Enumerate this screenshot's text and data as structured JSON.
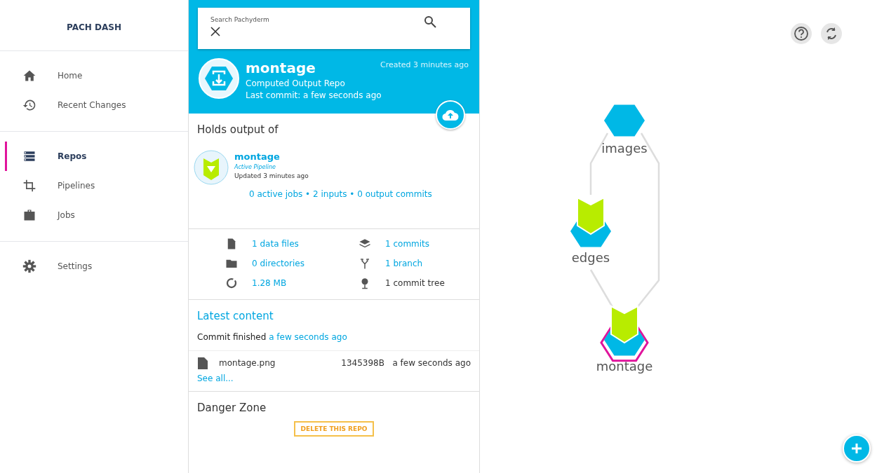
{
  "sidebar": {
    "title": "PACH DASH",
    "groups": [
      {
        "items": [
          {
            "label": "Home",
            "selected": false
          },
          {
            "label": "Recent Changes",
            "selected": false
          }
        ]
      },
      {
        "items": [
          {
            "label": "Repos",
            "selected": true
          },
          {
            "label": "Pipelines",
            "selected": false
          },
          {
            "label": "Jobs",
            "selected": false
          }
        ]
      },
      {
        "items": [
          {
            "label": "Settings",
            "selected": false
          }
        ]
      }
    ]
  },
  "search": {
    "placeholder": "Search Pachyderm"
  },
  "repo": {
    "name": "montage",
    "type": "Computed Output Repo",
    "last_commit": "Last commit: a few seconds ago",
    "created": "Created 3 minutes ago"
  },
  "holds_output": {
    "title": "Holds output of",
    "pipeline": {
      "name": "montage",
      "status": "Active Pipeline",
      "updated": "Updated 3 minutes ago",
      "summary": "0 active jobs • 2 inputs • 0 output commits"
    }
  },
  "stats": [
    {
      "text": "1 data files",
      "link": true
    },
    {
      "text": "1 commits",
      "link": true
    },
    {
      "text": "0 directories",
      "link": true
    },
    {
      "text": "1 branch",
      "link": true
    },
    {
      "text": "1.28 MB",
      "link": true
    },
    {
      "text": "1 commit tree",
      "link": false
    }
  ],
  "latest_content": {
    "title": "Latest content",
    "commit_label": "Commit finished",
    "commit_time": "a few seconds ago",
    "files": [
      {
        "name": "montage.png",
        "size": "1345398B",
        "time": "a few seconds ago"
      }
    ],
    "see_all": "See all..."
  },
  "danger_zone": {
    "title": "Danger Zone",
    "button": "DELETE THIS REPO"
  },
  "graph": {
    "nodes": [
      {
        "label": "images",
        "kind": "repo",
        "selected": false
      },
      {
        "label": "edges",
        "kind": "pipeline",
        "selected": false
      },
      {
        "label": "montage",
        "kind": "pipeline",
        "selected": true
      }
    ]
  }
}
